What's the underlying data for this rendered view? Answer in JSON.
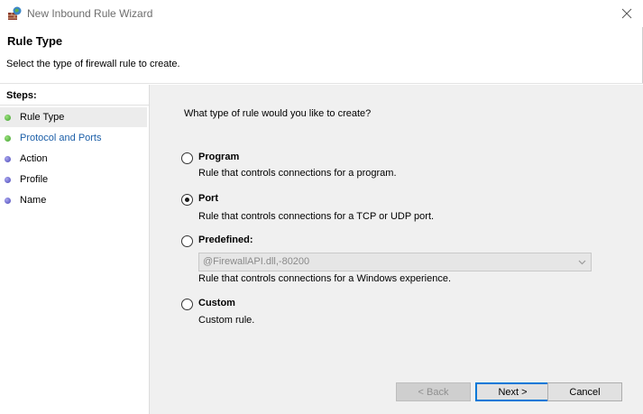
{
  "window": {
    "title": "New Inbound Rule Wizard"
  },
  "header": {
    "title": "Rule Type",
    "subtitle": "Select the type of firewall rule to create."
  },
  "sidebar": {
    "label": "Steps:",
    "steps": [
      {
        "label": "Rule Type",
        "status": "green",
        "active": true
      },
      {
        "label": "Protocol and Ports",
        "status": "green",
        "active": false
      },
      {
        "label": "Action",
        "status": "blue",
        "active": false
      },
      {
        "label": "Profile",
        "status": "blue",
        "active": false
      },
      {
        "label": "Name",
        "status": "blue",
        "active": false
      }
    ]
  },
  "main": {
    "question": "What type of rule would you like to create?",
    "options": [
      {
        "title": "Program",
        "description": "Rule that controls connections for a program.",
        "selected": false
      },
      {
        "title": "Port",
        "description": "Rule that controls connections for a TCP or UDP port.",
        "selected": true
      },
      {
        "title": "Predefined:",
        "description": "Rule that controls connections for a Windows experience.",
        "selected": false
      },
      {
        "title": "Custom",
        "description": "Custom rule.",
        "selected": false
      }
    ],
    "predefined_select": {
      "value": "@FirewallAPI.dll,-80200",
      "disabled": true
    }
  },
  "buttons": {
    "back": "< Back",
    "next": "Next >",
    "cancel": "Cancel"
  },
  "colors": {
    "accent": "#0078d7",
    "link": "#1c5fa8",
    "step_done": "#3f9f2e",
    "step_pending": "#4b48b8"
  }
}
